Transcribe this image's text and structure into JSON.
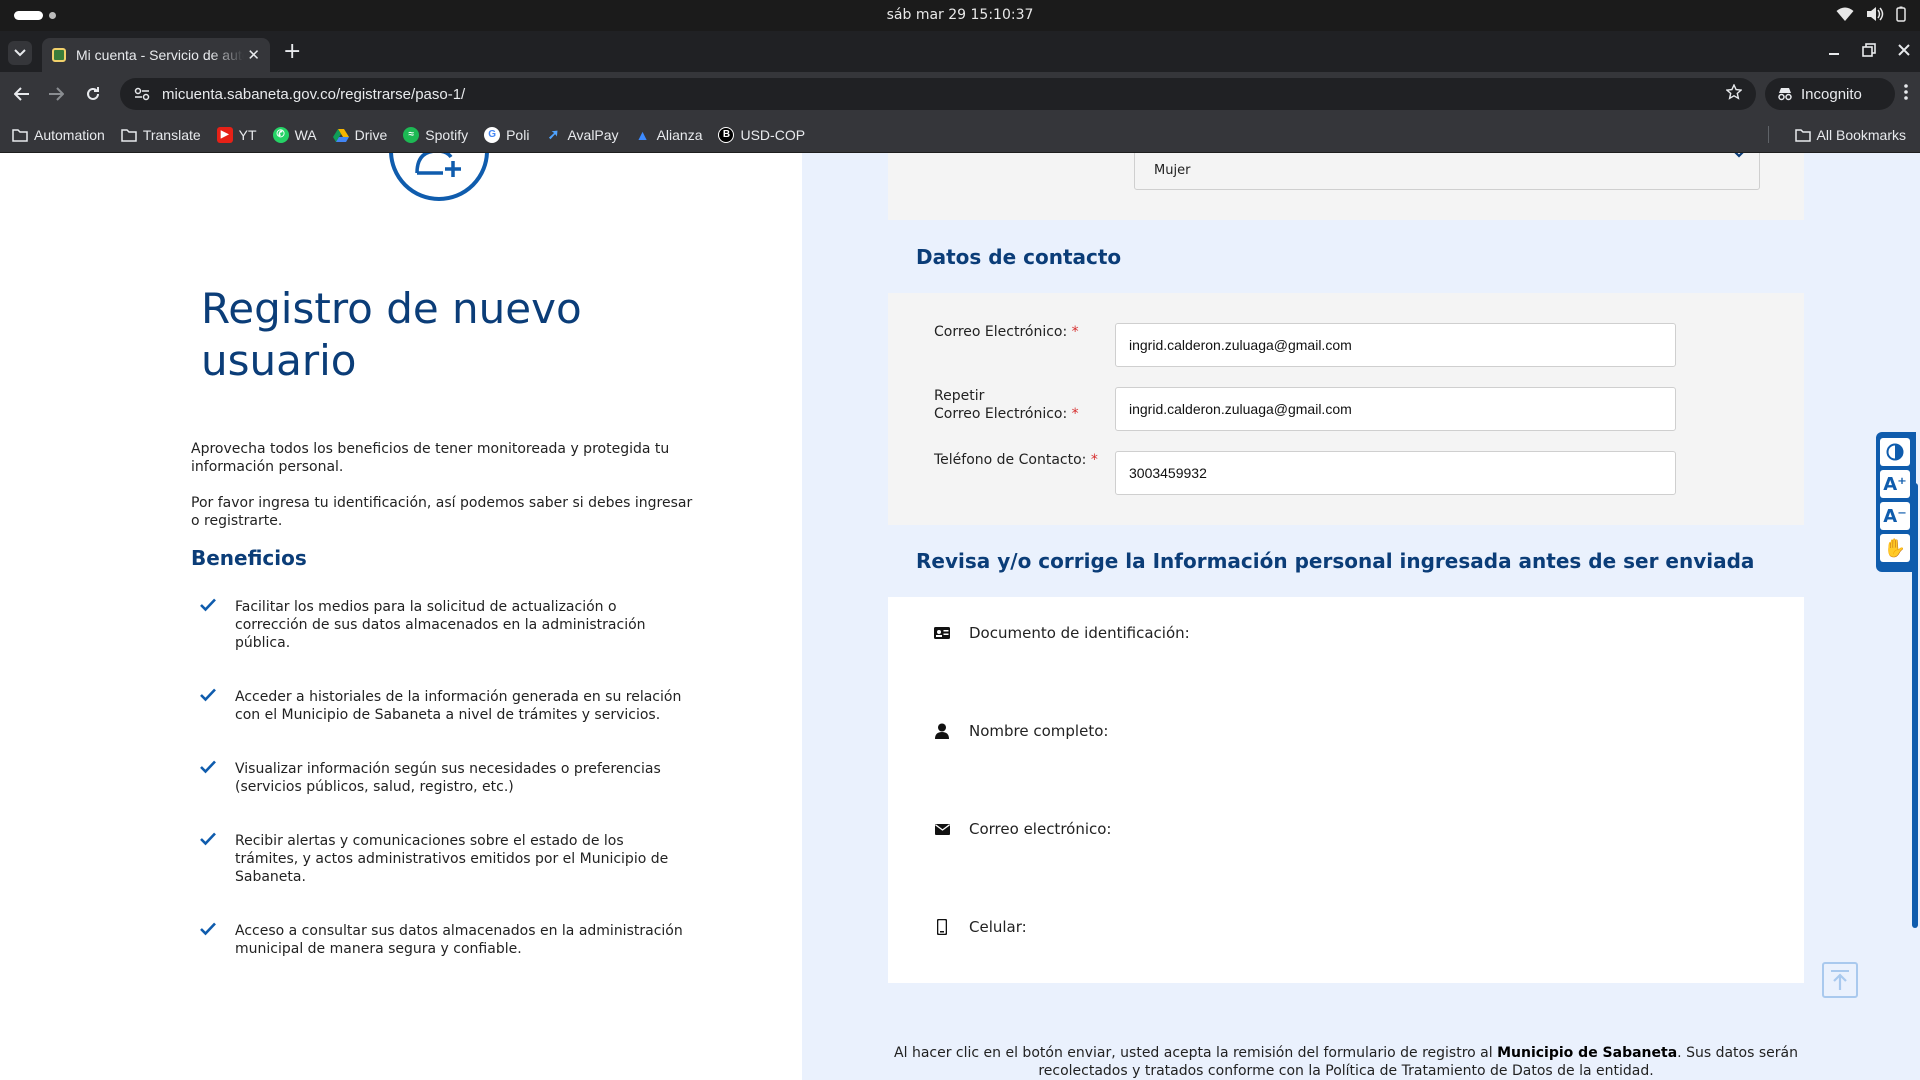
{
  "os": {
    "clock": "sáb mar 29  15:10:37"
  },
  "browser": {
    "tab_title": "Mi cuenta - Servicio de autenticación",
    "url": "micuenta.sabaneta.gov.co/registrarse/paso-1/",
    "incognito_label": "Incognito",
    "bookmarks": [
      "Automation",
      "Translate",
      "YT",
      "WA",
      "Drive",
      "Spotify",
      "Poli",
      "AvalPay",
      "Alianza",
      "USD-COP"
    ],
    "all_bookmarks": "All Bookmarks"
  },
  "left": {
    "title": "Registro de nuevo usuario",
    "intro1": "Aprovecha todos los beneficios de tener monitoreada y protegida tu información personal.",
    "intro2": "Por favor ingresa tu identificación, así podemos saber si debes ingresar o registrarte.",
    "benefits_title": "Beneficios",
    "benefits": [
      "Facilitar los medios para la solicitud de actualización o corrección de sus datos almacenados en la administración pública.",
      "Acceder a historiales de la información generada en su relación con el Municipio de Sabaneta a nivel de trámites y servicios.",
      "Visualizar información según sus necesidades o preferencias (servicios públicos, salud, registro, etc.)",
      "Recibir alertas y comunicaciones sobre el estado de los trámites, y actos administrativos emitidos por el Municipio de Sabaneta.",
      "Acceso a consultar sus datos almacenados en la administración municipal de manera segura y confiable."
    ]
  },
  "form": {
    "sex_value": "Mujer",
    "contact_title": "Datos de contacto",
    "email_label": "Correo Electrónico:",
    "email_value": "ingrid.calderon.zuluaga@gmail.com",
    "repeat_label_1": "Repetir",
    "repeat_label_2": "Correo Electrónico:",
    "repeat_value": "ingrid.calderon.zuluaga@gmail.com",
    "phone_label": "Teléfono de Contacto:",
    "phone_value": "3003459932",
    "required_mark": "*",
    "review_title": "Revisa y/o corrige la Información personal ingresada antes de ser enviada",
    "review_rows": [
      "Documento de identificación:",
      "Nombre completo:",
      "Correo electrónico:",
      "Celular:"
    ],
    "footer_pre": "Al hacer clic en el botón enviar, usted acepta la remisión del formulario de registro al",
    "footer_bold": "Municipio de Sabaneta",
    "footer_post": ". Sus datos serán recolectados y tratados conforme con la Política de Tratamiento de Datos de la entidad."
  },
  "a11y": {
    "buttons": [
      "contrast-icon",
      "font-increase-icon",
      "font-decrease-icon",
      "sign-language-icon"
    ]
  },
  "colors": {
    "brand": "#0f5cad",
    "title": "#0b3d78",
    "right_bg": "#eaf1fd",
    "required": "#d62d2d"
  }
}
